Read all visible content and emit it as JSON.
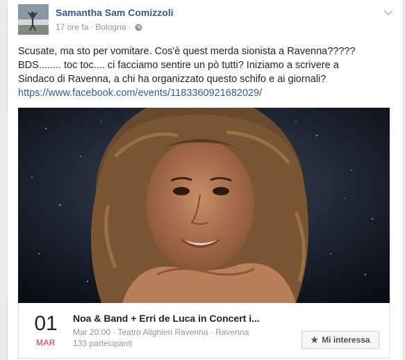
{
  "post": {
    "author": "Samantha Sam Comizzoli",
    "time": "17 ore fa",
    "separator": "·",
    "location": "Bologna",
    "privacy_icon": "globe-icon",
    "menu_icon": "chevron-down-icon",
    "text_lines": [
      "Scusate, ma sto per vomitare. Cos'è quest merda sionista a Ravenna?????",
      "BDS........ toc toc.... ci facciamo sentire un pò tutti? Iniziamo a scrivere a",
      "Sindaco di Ravenna, a chi ha organizzato questo schifo e ai giornali?"
    ],
    "link": "https://www.facebook.com/events/1183360921682029/"
  },
  "event": {
    "day": "01",
    "month": "MAR",
    "title": "Noa & Band + Erri de Luca in Concert i...",
    "details": "Mar 20:00 · Teatro Alighieri Ravenna · Ravenna",
    "participants": "133 partecipanti",
    "interest_icon": "star-icon",
    "interest_label": "Mi interessa"
  },
  "colors": {
    "link": "#365899",
    "month": "#f02849",
    "background": "#e9ebee"
  }
}
